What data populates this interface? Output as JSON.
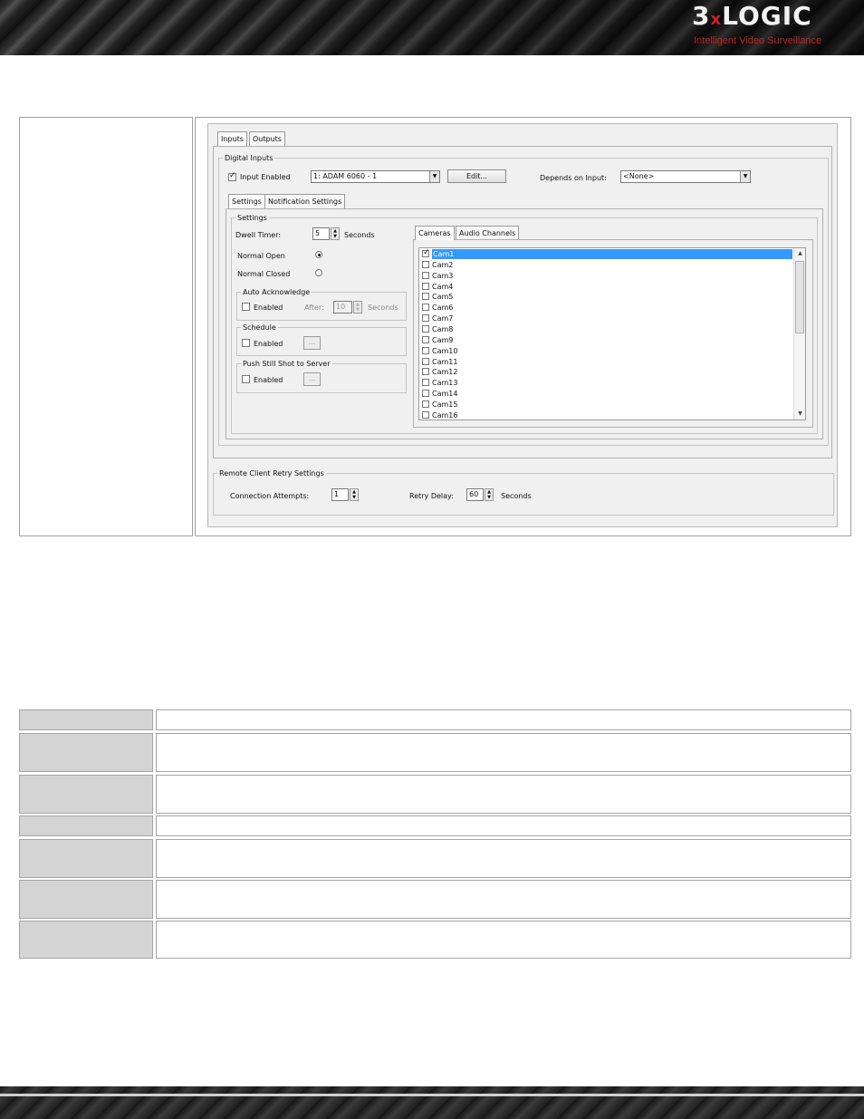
{
  "header": {
    "logo_brand_part1": "3",
    "logo_brand_x": "x",
    "logo_brand_part2": "LOGIC",
    "logo_tagline": "Intelligent Video Surveillance"
  },
  "dialog": {
    "main_tabs": [
      "Inputs",
      "Outputs"
    ],
    "digital_inputs": {
      "title": "Digital Inputs",
      "input_enabled_label": "Input Enabled",
      "input_enabled_checked": true,
      "device_select": "1: ADAM 6060 - 1",
      "edit_button": "Edit...",
      "depends_on_label": "Depends on Input:",
      "depends_on_select": "<None>"
    },
    "sub_tabs": [
      "Settings",
      "Notification Settings"
    ],
    "settings": {
      "title": "Settings",
      "dwell_timer_label": "Dwell Timer:",
      "dwell_timer_value": "5",
      "dwell_timer_unit": "Seconds",
      "normal_open_label": "Normal Open",
      "normal_open_selected": true,
      "normal_closed_label": "Normal Closed",
      "auto_ack": {
        "title": "Auto Acknowledge",
        "enabled_label": "Enabled",
        "after_label": "After:",
        "after_value": "10",
        "after_unit": "Seconds"
      },
      "schedule": {
        "title": "Schedule",
        "enabled_label": "Enabled",
        "browse_label": "..."
      },
      "push_still": {
        "title": "Push Still Shot to Server",
        "enabled_label": "Enabled",
        "browse_label": "..."
      }
    },
    "channel_tabs": [
      "Cameras",
      "Audio Channels"
    ],
    "cameras": [
      {
        "name": "Cam1",
        "checked": true,
        "selected": true
      },
      {
        "name": "Cam2",
        "checked": false
      },
      {
        "name": "Cam3",
        "checked": false
      },
      {
        "name": "Cam4",
        "checked": false
      },
      {
        "name": "Cam5",
        "checked": false
      },
      {
        "name": "Cam6",
        "checked": false
      },
      {
        "name": "Cam7",
        "checked": false
      },
      {
        "name": "Cam8",
        "checked": false
      },
      {
        "name": "Cam9",
        "checked": false
      },
      {
        "name": "Cam10",
        "checked": false
      },
      {
        "name": "Cam11",
        "checked": false
      },
      {
        "name": "Cam12",
        "checked": false
      },
      {
        "name": "Cam13",
        "checked": false
      },
      {
        "name": "Cam14",
        "checked": false
      },
      {
        "name": "Cam15",
        "checked": false
      },
      {
        "name": "Cam16",
        "checked": false
      }
    ],
    "remote_retry": {
      "title": "Remote Client Retry Settings",
      "connection_attempts_label": "Connection Attempts:",
      "connection_attempts_value": "1",
      "retry_delay_label": "Retry Delay:",
      "retry_delay_value": "60",
      "retry_delay_unit": "Seconds"
    }
  },
  "colors": {
    "selection": "#3399ff",
    "brand_red": "#c81e1e",
    "label_cell": "#d4d4d4"
  }
}
